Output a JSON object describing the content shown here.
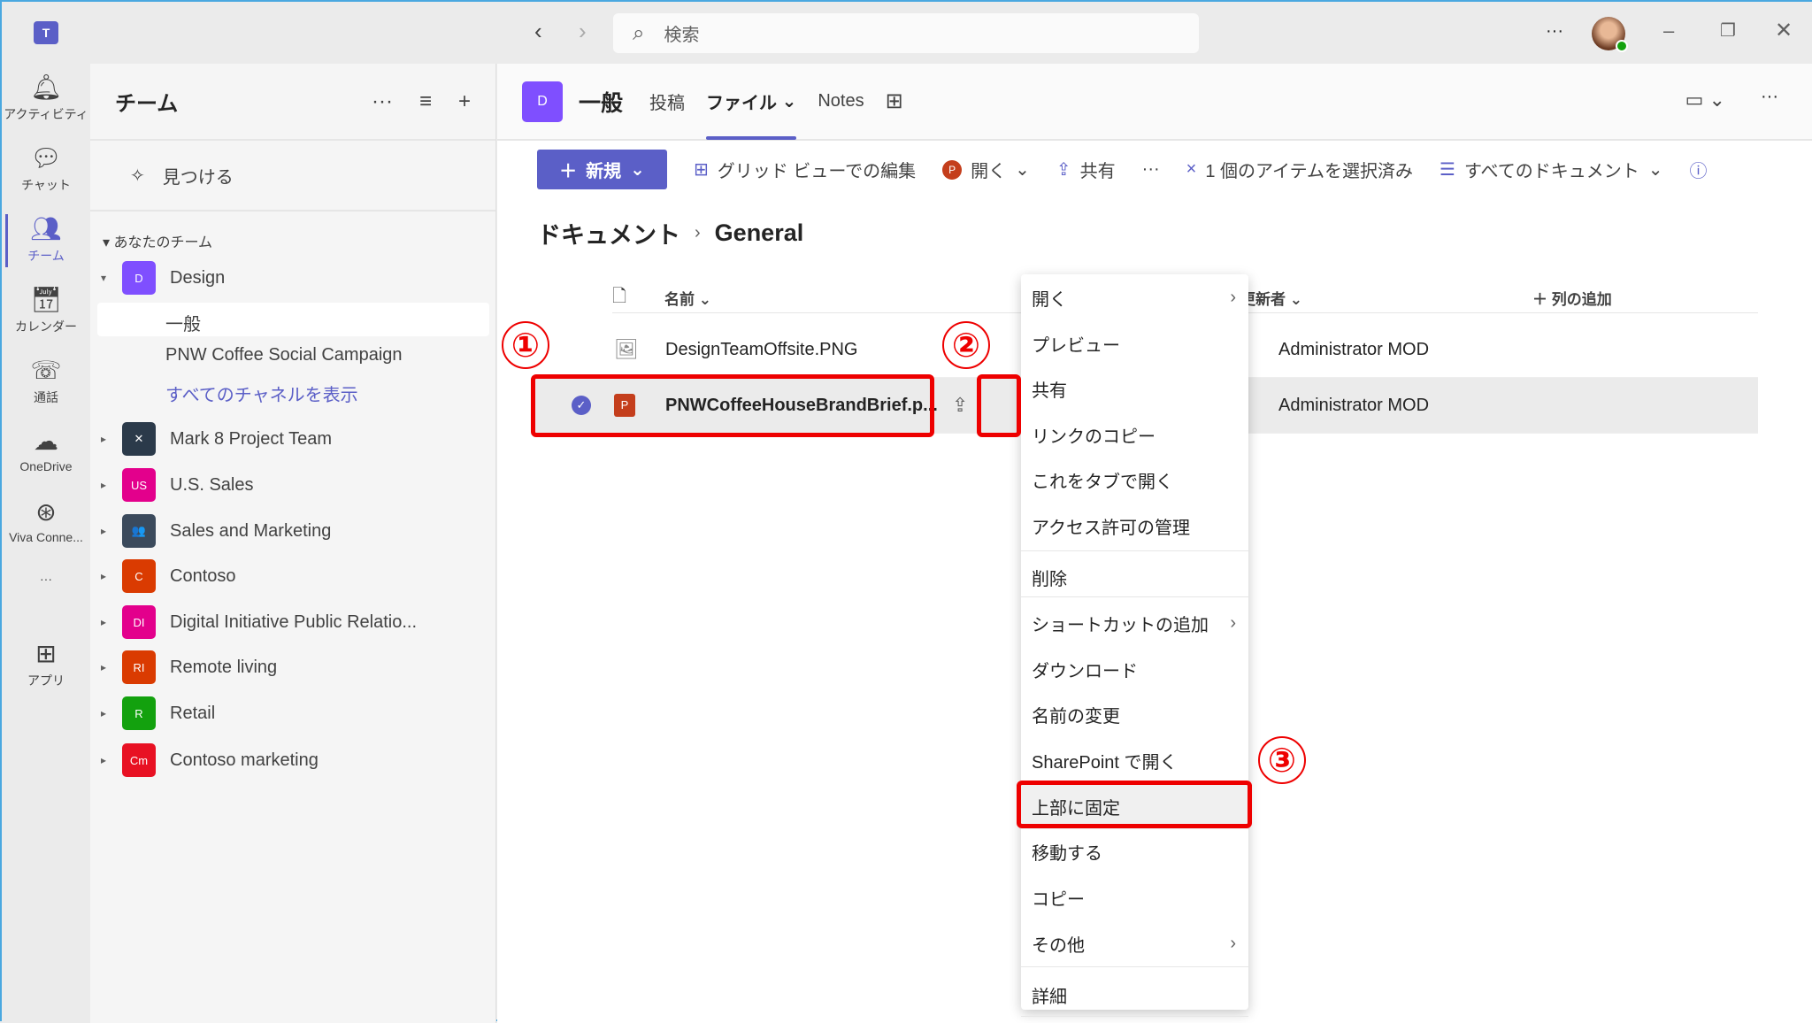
{
  "titlebar": {
    "search_placeholder": "検索",
    "more": "···"
  },
  "rail": [
    {
      "label": "アクティビティ",
      "icon": "bell-icon"
    },
    {
      "label": "チャット",
      "icon": "chat-icon"
    },
    {
      "label": "チーム",
      "icon": "teams-icon"
    },
    {
      "label": "カレンダー",
      "icon": "calendar-icon"
    },
    {
      "label": "通話",
      "icon": "phone-icon"
    },
    {
      "label": "OneDrive",
      "icon": "cloud-icon"
    },
    {
      "label": "Viva Conne...",
      "icon": "viva-icon"
    },
    {
      "label": "···",
      "icon": "more-icon"
    },
    {
      "label": "アプリ",
      "icon": "apps-icon"
    }
  ],
  "teams_panel": {
    "title": "チーム",
    "find": "見つける",
    "section": "あなたのチーム",
    "teams": [
      {
        "name": "Design",
        "initials": "D",
        "color": "#7f4fff",
        "expanded": true
      },
      {
        "name": "Mark 8 Project Team",
        "initials": "✕",
        "color": "#2b3a4a"
      },
      {
        "name": "U.S. Sales",
        "initials": "US",
        "color": "#e3008c"
      },
      {
        "name": "Sales and Marketing",
        "initials": "👥",
        "color": "#3b4a5c"
      },
      {
        "name": "Contoso",
        "initials": "C",
        "color": "#da3b01"
      },
      {
        "name": "Digital Initiative Public Relatio...",
        "initials": "DI",
        "color": "#e3008c"
      },
      {
        "name": "Remote living",
        "initials": "RI",
        "color": "#da3b01"
      },
      {
        "name": "Retail",
        "initials": "R",
        "color": "#13a10e"
      },
      {
        "name": "Contoso marketing",
        "initials": "Cm",
        "color": "#e81123"
      }
    ],
    "channels": [
      "一般",
      "PNW Coffee Social Campaign",
      "すべてのチャネルを表示"
    ]
  },
  "channel": {
    "initial": "D",
    "name": "一般",
    "tabs": [
      "投稿",
      "ファイル",
      "Notes"
    ],
    "active_tab": "ファイル"
  },
  "toolbar": {
    "new": "新規",
    "grid_edit": "グリッド ビューでの編集",
    "open": "開く",
    "share": "共有",
    "more": "···",
    "selected": "1 個のアイテムを選択済み",
    "view": "すべてのドキュメント"
  },
  "breadcrumb": [
    "ドキュメント",
    "General"
  ],
  "columns": {
    "name": "名前",
    "modified_by": "更新者",
    "add_column": "列の追加"
  },
  "files": [
    {
      "name": "DesignTeamOffsite.PNG",
      "modified_by": "Administrator MOD",
      "selected": false
    },
    {
      "name": "PNWCoffeeHouseBrandBrief.p...",
      "modified_by": "Administrator MOD",
      "selected": true
    }
  ],
  "context_menu": [
    {
      "label": "開く",
      "submenu": true
    },
    {
      "label": "プレビュー"
    },
    {
      "label": "共有"
    },
    {
      "label": "リンクのコピー"
    },
    {
      "label": "これをタブで開く"
    },
    {
      "label": "アクセス許可の管理"
    },
    {
      "label": "削除"
    },
    {
      "label": "ショートカットの追加",
      "submenu": true
    },
    {
      "label": "ダウンロード"
    },
    {
      "label": "名前の変更"
    },
    {
      "label": "SharePoint で開く"
    },
    {
      "label": "上部に固定",
      "highlighted": true
    },
    {
      "label": "移動する"
    },
    {
      "label": "コピー"
    },
    {
      "label": "その他",
      "submenu": true
    },
    {
      "label": "詳細"
    }
  ],
  "annotations": [
    "①",
    "②",
    "③"
  ],
  "colors": {
    "accent": "#5b5fc7",
    "annotation": "#ee0000"
  }
}
